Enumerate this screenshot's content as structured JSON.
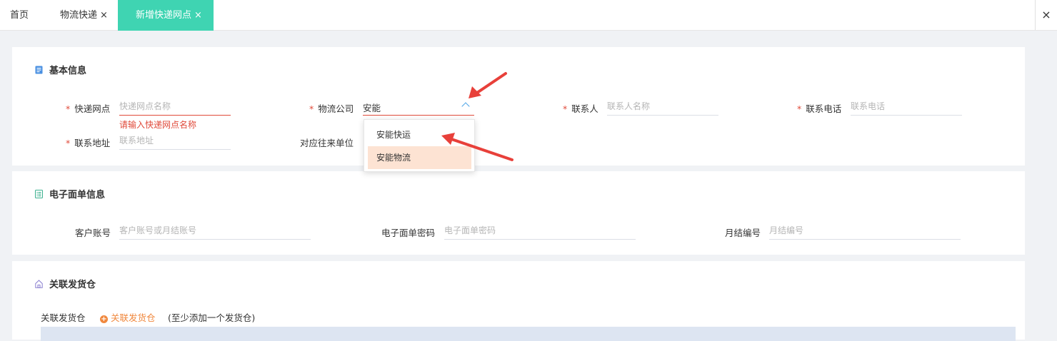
{
  "tabs": {
    "home": "首页",
    "logistics": "物流快递",
    "active": "新增快递网点",
    "close_glyph": "×",
    "close_all_glyph": "×"
  },
  "basic_info": {
    "title": "基本信息",
    "required_mark": "*",
    "express_point": {
      "label": "快递网点",
      "placeholder": "快递网点名称",
      "value": "",
      "error": "请输入快递网点名称"
    },
    "logistics_company": {
      "label": "物流公司",
      "value": "安能",
      "options": [
        "安能快运",
        "安能物流"
      ],
      "highlighted_option": "安能物流"
    },
    "contact": {
      "label": "联系人",
      "placeholder": "联系人名称"
    },
    "phone": {
      "label": "联系电话",
      "placeholder": "联系电话"
    },
    "address": {
      "label": "联系地址",
      "placeholder": "联系地址"
    },
    "counterparty": {
      "label": "对应往来单位"
    }
  },
  "waybill_info": {
    "title": "电子面单信息",
    "account": {
      "label": "客户账号",
      "placeholder": "客户账号或月结账号"
    },
    "password": {
      "label": "电子面单密码",
      "placeholder": "电子面单密码"
    },
    "monthly_no": {
      "label": "月结编号",
      "placeholder": "月结编号"
    }
  },
  "warehouse": {
    "title": "关联发货仓",
    "label": "关联发货仓",
    "add_button": "关联发货仓",
    "hint": "(至少添加一个发货仓)"
  },
  "colors": {
    "accent": "#3fd4b2",
    "error": "#e04a3a",
    "highlight": "#fde3d3",
    "annotation_arrow": "#e8403a"
  },
  "icons": [
    "close-icon",
    "document-icon",
    "list-icon",
    "home-icon",
    "chevron-up-icon",
    "plus-circle-icon"
  ]
}
